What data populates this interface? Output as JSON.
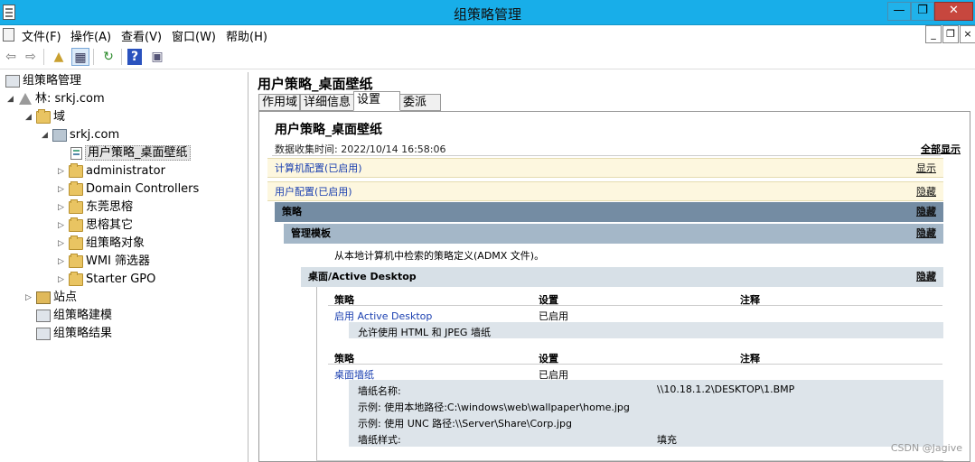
{
  "window": {
    "title": "组策略管理",
    "minimize": "—",
    "maximize": "❐",
    "close": "✕"
  },
  "menu": [
    "文件(F)",
    "操作(A)",
    "查看(V)",
    "窗口(W)",
    "帮助(H)"
  ],
  "mdi": {
    "min": "_",
    "restore": "❐",
    "close": "×"
  },
  "toolbar": {
    "back": "⇦",
    "forward": "⇨",
    "up": "▲",
    "show_hide": "▦",
    "refresh": "↻",
    "help": "?",
    "properties": "▣"
  },
  "tree": [
    {
      "label": "组策略管理",
      "icon": "gpm-icon",
      "exp": ""
    },
    {
      "label": "林: srkj.com",
      "icon": "forest-icon",
      "exp": "◢"
    },
    {
      "label": "域",
      "icon": "folder-icon",
      "exp": "◢"
    },
    {
      "label": "srkj.com",
      "icon": "domain-icon",
      "exp": "◢"
    },
    {
      "label": "用户策略_桌面壁纸",
      "icon": "gpo-link-icon",
      "exp": ""
    },
    {
      "label": "administrator",
      "icon": "folder-icon",
      "exp": "▷"
    },
    {
      "label": "Domain Controllers",
      "icon": "folder-icon",
      "exp": "▷"
    },
    {
      "label": "东莞思榕",
      "icon": "folder-icon",
      "exp": "▷"
    },
    {
      "label": "思榕其它",
      "icon": "folder-icon",
      "exp": "▷"
    },
    {
      "label": "组策略对象",
      "icon": "folder-icon",
      "exp": "▷"
    },
    {
      "label": "WMI 筛选器",
      "icon": "folder-icon",
      "exp": "▷"
    },
    {
      "label": "Starter GPO",
      "icon": "folder-icon",
      "exp": "▷"
    },
    {
      "label": "站点",
      "icon": "site-icon",
      "exp": "▷"
    },
    {
      "label": "组策略建模",
      "icon": "gpm-icon",
      "exp": ""
    },
    {
      "label": "组策略结果",
      "icon": "gpm-icon",
      "exp": ""
    }
  ],
  "right": {
    "title": "用户策略_桌面壁纸",
    "tabs": [
      "作用域",
      "详细信息",
      "设置",
      "委派"
    ],
    "active_tab": 2
  },
  "report": {
    "title": "用户策略_桌面壁纸",
    "collected": "数据收集时间: 2022/10/14 16:58:06",
    "show_all": "全部显示",
    "computer_config": "计算机配置(已启用)",
    "computer_action": "显示",
    "user_config": "用户配置(已启用)",
    "user_action": "隐藏",
    "policies": "策略",
    "policies_action": "隐藏",
    "admin_templates": "管理模板",
    "admin_action": "隐藏",
    "admx_note": "从本地计算机中检索的策略定义(ADMX 文件)。",
    "desktop_section": "桌面/Active Desktop",
    "desktop_action": "隐藏",
    "col_policy": "策略",
    "col_setting": "设置",
    "col_comment": "注释",
    "row1_policy": "启用 Active Desktop",
    "row1_setting": "已启用",
    "row1_detail": "允许使用 HTML 和 JPEG 墙纸",
    "row2_policy": "桌面墙纸",
    "row2_setting": "已启用",
    "wp_name_label": "墙纸名称:",
    "wp_name_value": "\\\\10.18.1.2\\DESKTOP\\1.BMP",
    "example_local": "示例: 使用本地路径:C:\\windows\\web\\wallpaper\\home.jpg",
    "example_unc": "示例: 使用 UNC 路径:\\\\Server\\Share\\Corp.jpg",
    "wp_style_label": "墙纸样式:",
    "wp_style_value": "填充"
  },
  "watermark": "CSDN @Jagive"
}
